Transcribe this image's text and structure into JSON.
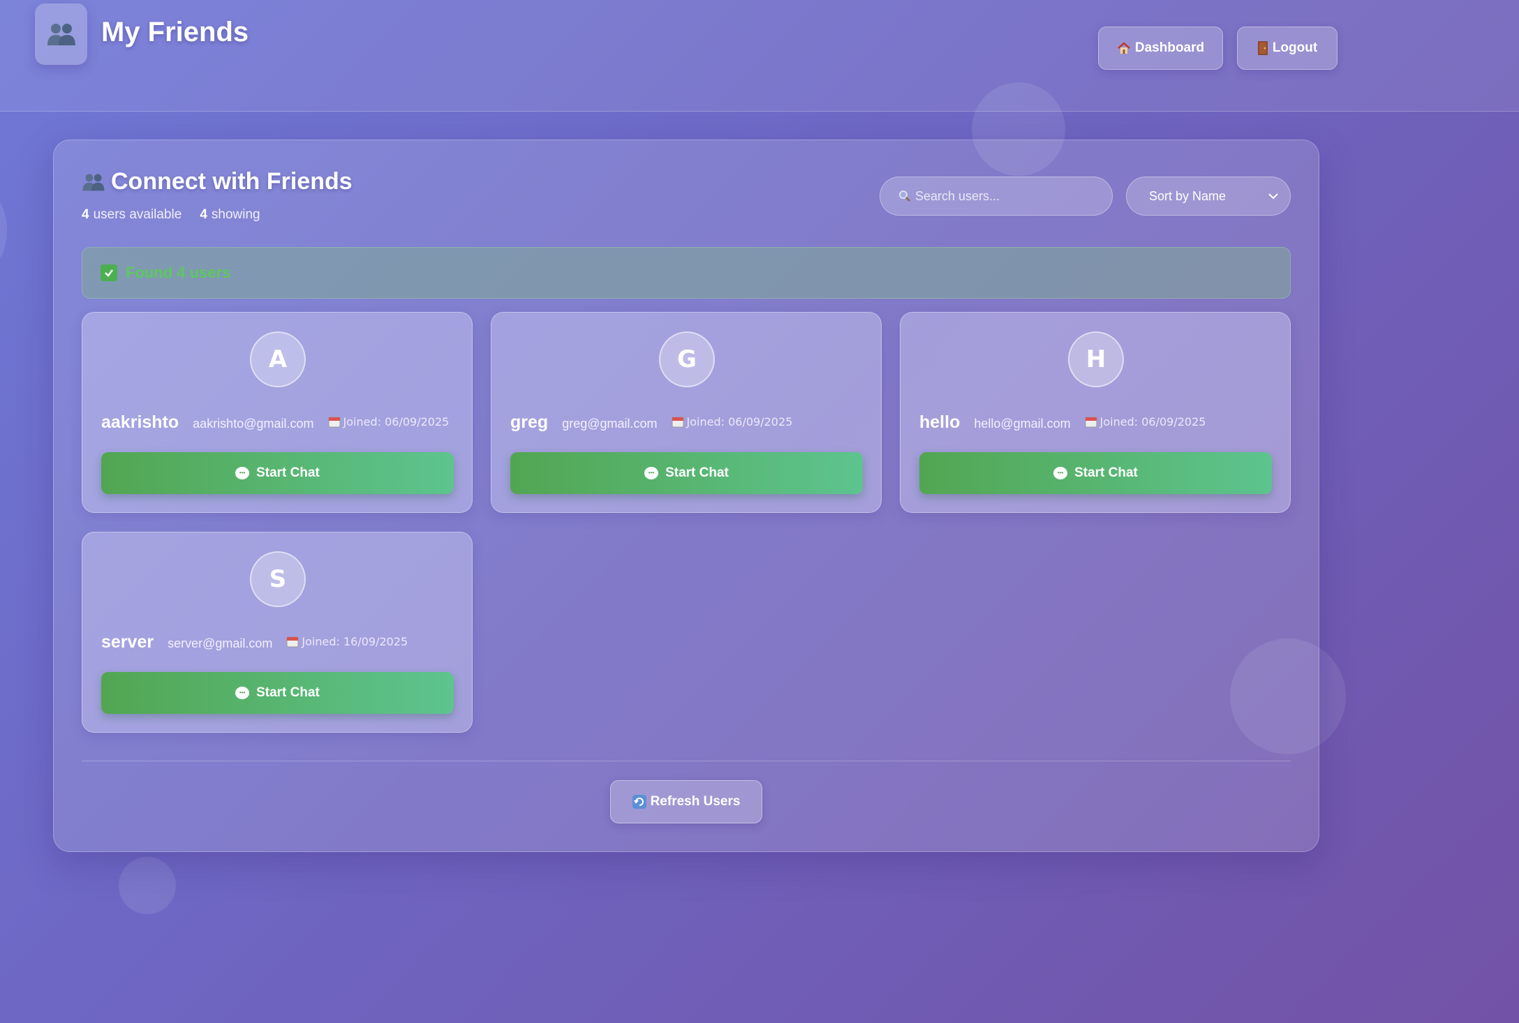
{
  "header": {
    "title": "My Friends",
    "logo_icon": "friends-icon",
    "dashboard_label": "Dashboard",
    "dashboard_icon": "house-icon",
    "logout_label": "Logout",
    "logout_icon": "door-icon"
  },
  "panel": {
    "title": "Connect with Friends",
    "title_icon": "friends-icon",
    "stats": {
      "available_count": "4",
      "available_label": "users available",
      "showing_count": "4",
      "showing_label": "showing"
    },
    "search": {
      "placeholder": "Search users...",
      "value": ""
    },
    "sort": {
      "selected": "Sort by Name"
    },
    "banner": {
      "text": "Found 4 users",
      "icon": "check-icon",
      "color": "#5cc85f"
    },
    "users": [
      {
        "initial": "A",
        "name": "aakrishto",
        "email": "aakrishto@gmail.com",
        "joined": "Joined: 06/09/2025",
        "button": "Start Chat"
      },
      {
        "initial": "G",
        "name": "greg",
        "email": "greg@gmail.com",
        "joined": "Joined: 06/09/2025",
        "button": "Start Chat"
      },
      {
        "initial": "H",
        "name": "hello",
        "email": "hello@gmail.com",
        "joined": "Joined: 06/09/2025",
        "button": "Start Chat"
      },
      {
        "initial": "S",
        "name": "server",
        "email": "server@gmail.com",
        "joined": "Joined: 16/09/2025",
        "button": "Start Chat"
      }
    ],
    "refresh_label": "Refresh Users",
    "refresh_icon": "refresh-icon"
  },
  "colors": {
    "background_start": "#6f78d6",
    "background_end": "#7252a6",
    "chat_button_start": "#52a652",
    "chat_button_end": "#5dc48f"
  }
}
